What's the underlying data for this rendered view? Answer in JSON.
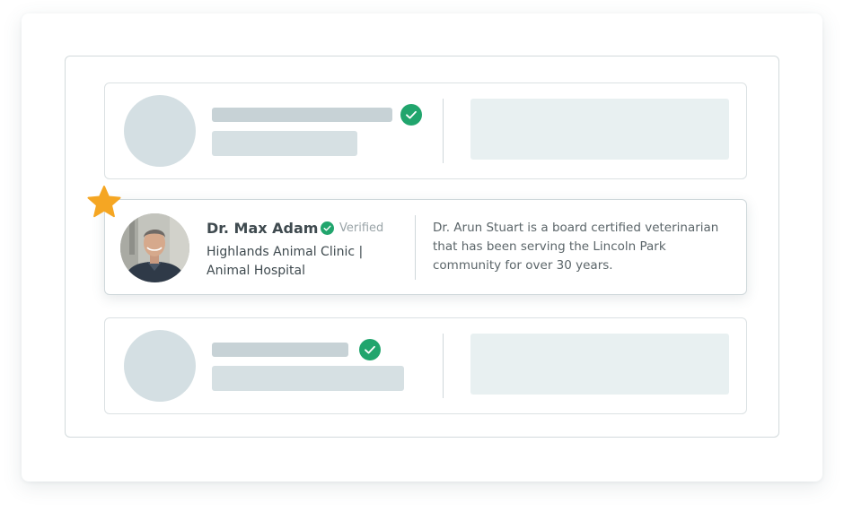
{
  "featured_listing": {
    "name": "Dr. Max Adam",
    "verified_label": "Verified",
    "clinic": "Highlands  Animal Clinic | Animal Hospital",
    "bio": "Dr. Arun Stuart is a board certified veterinarian that has been serving the Lincoln Park community for over 30 years.",
    "photo_icon": "doctor-portrait",
    "badge_icon": "star-icon"
  },
  "colors": {
    "verified_green": "#21a56d",
    "star_orange": "#f5a623",
    "placeholder_gray": "#c7d2d6",
    "placeholder_light": "#e8f0f1"
  }
}
